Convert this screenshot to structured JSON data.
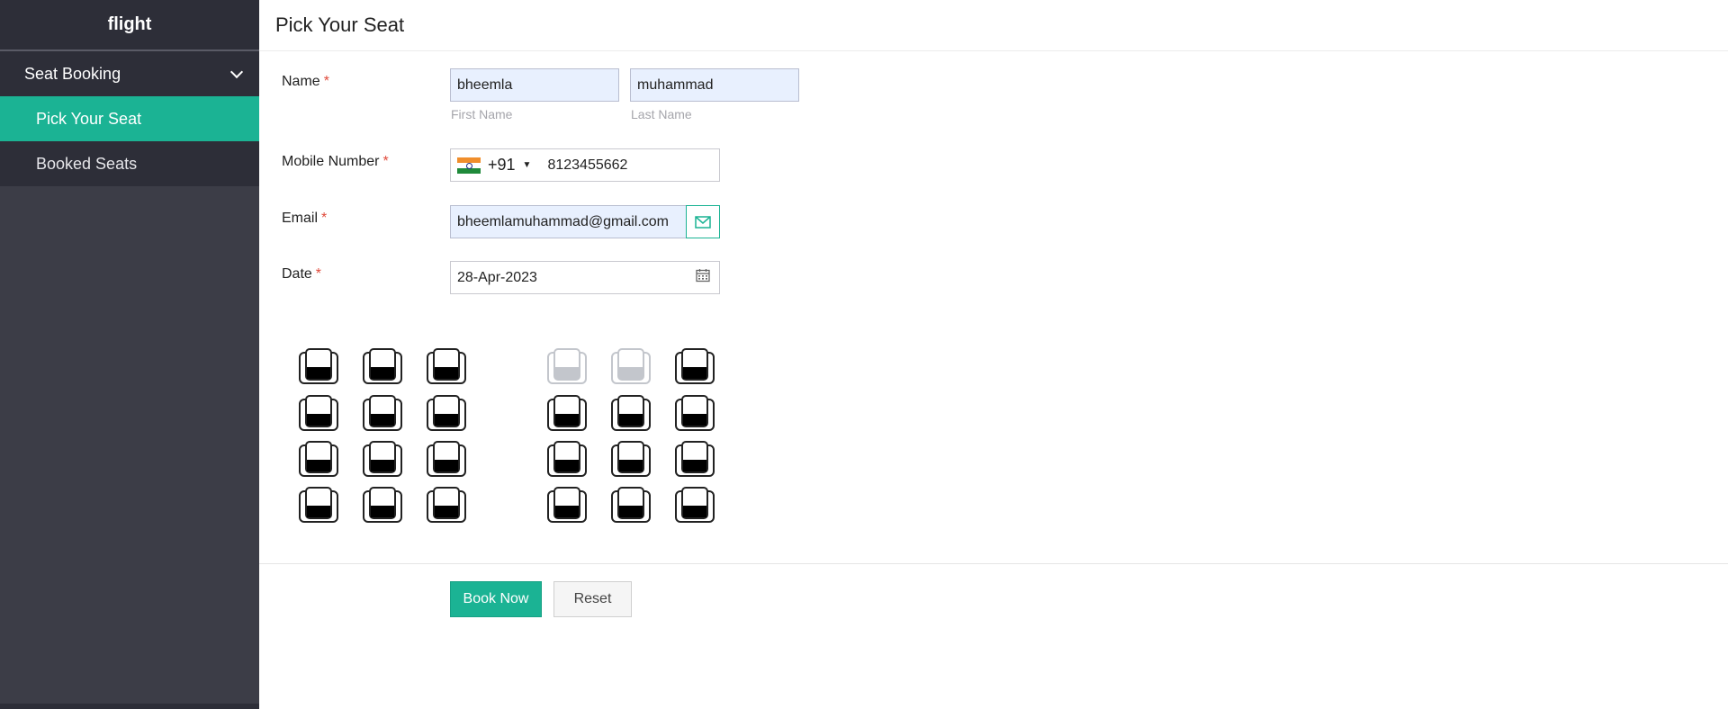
{
  "sidebar": {
    "brand": "flight",
    "group_label": "Seat Booking",
    "items": [
      {
        "label": "Pick Your Seat",
        "active": true
      },
      {
        "label": "Booked Seats",
        "active": false
      }
    ]
  },
  "header": {
    "title": "Pick Your Seat"
  },
  "form": {
    "name": {
      "label": "Name",
      "first_value": "bheemla",
      "first_hint": "First Name",
      "last_value": "muhammad",
      "last_hint": "Last Name"
    },
    "mobile": {
      "label": "Mobile Number",
      "country_code": "+91",
      "country_flag": "india-flag-icon",
      "value": "8123455662"
    },
    "email": {
      "label": "Email",
      "value": "bheemlamuhammad@gmail.com",
      "icon": "envelope-icon"
    },
    "date": {
      "label": "Date",
      "value": "28-Apr-2023",
      "icon": "calendar-icon"
    },
    "required_marker": "*"
  },
  "seats": {
    "left_block": [
      [
        "available",
        "available",
        "available"
      ],
      [
        "available",
        "available",
        "available"
      ],
      [
        "available",
        "available",
        "available"
      ],
      [
        "available",
        "available",
        "available"
      ]
    ],
    "right_block": [
      [
        "booked",
        "booked",
        "available"
      ],
      [
        "available",
        "available",
        "available"
      ],
      [
        "available",
        "available",
        "available"
      ],
      [
        "available",
        "available",
        "available"
      ]
    ]
  },
  "actions": {
    "book_label": "Book Now",
    "reset_label": "Reset"
  },
  "colors": {
    "accent": "#1bb394",
    "sidebar_bg": "#3c3d47",
    "sidebar_dark": "#2d2e38",
    "required": "#e04a3b",
    "booked_seat": "#c3c6cc"
  }
}
